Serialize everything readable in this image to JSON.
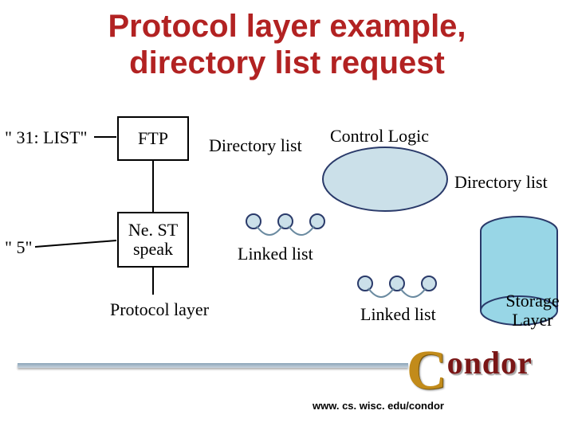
{
  "title_line1": "Protocol layer example,",
  "title_line2": "directory list request",
  "labels": {
    "q31": "\" 31: LIST\"",
    "q5": "\" 5\"",
    "ftp": "FTP",
    "nest": "Ne. ST speak",
    "dirlist_upper": "Directory list",
    "dirlist_right": "Directory list",
    "control_logic": "Control Logic",
    "linked_upper": "Linked list",
    "linked_lower": "Linked list",
    "protocol_layer": "Protocol layer",
    "storage_layer": "Storage Layer"
  },
  "footer_url": "www. cs. wisc. edu/condor",
  "logo": {
    "c": "C",
    "rest": "ondor"
  },
  "colors": {
    "title": "#b22222",
    "ellipse_fill": "#cbe0e9",
    "ellipse_stroke": "#2a3a6a",
    "cylinder_fill": "#98d6e6",
    "arc": "#6a8aa0"
  }
}
